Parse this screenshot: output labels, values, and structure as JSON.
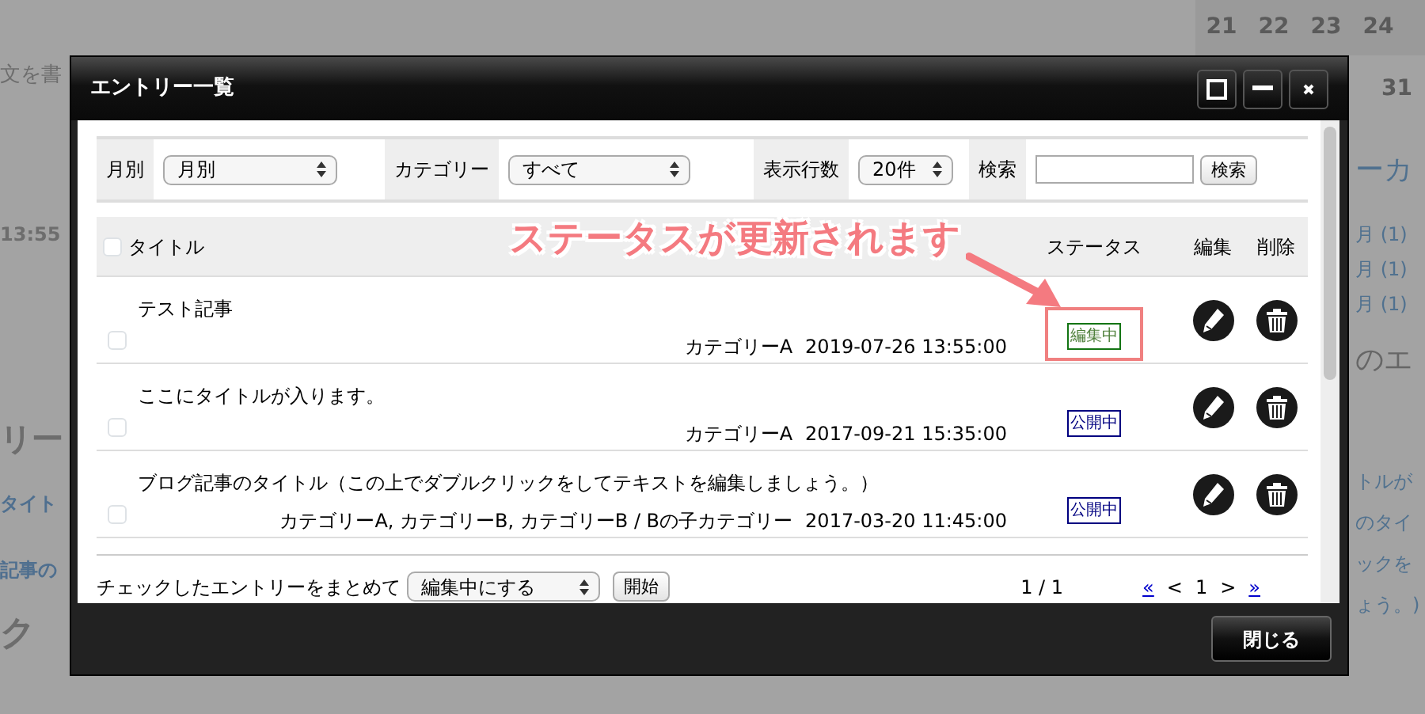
{
  "background": {
    "calendar": [
      "21",
      "22",
      "23",
      "24"
    ],
    "calendar_row_2": [
      "31"
    ],
    "left_texts": [
      "文を書",
      "13:55",
      "リー",
      "タイト",
      "記事の",
      "ク"
    ],
    "right_texts": [
      "ーカ",
      "月 (1)",
      "月 (1)",
      "月 (1)",
      "のエ",
      "トルが",
      "のタイ",
      "ックを",
      "ょう。)"
    ]
  },
  "window": {
    "title": "エントリー一覧"
  },
  "filters": [
    {
      "label": "月別",
      "value": "月別"
    },
    {
      "label": "カテゴリー",
      "value": "すべて"
    },
    {
      "label": "表示行数",
      "value": "20件"
    }
  ],
  "search": {
    "label": "検索",
    "button": "検索"
  },
  "table": {
    "select_all_checked": false,
    "columns": [
      "タイトル",
      "ステータス",
      "編集",
      "削除"
    ],
    "rows": [
      {
        "checked": false,
        "title": "テスト記事",
        "category": "カテゴリーA",
        "date": "2019-07-26 13:55:00",
        "status": "編集中",
        "kind": "draft",
        "highlighted": true
      },
      {
        "checked": false,
        "title": "ここにタイトルが入ります。",
        "category": "カテゴリーA",
        "date": "2017-09-21 15:35:00",
        "status": "公開中",
        "kind": "published",
        "highlighted": false
      },
      {
        "checked": false,
        "title": "ブログ記事のタイトル（この上でダブルクリックをしてテキストを編集しましょう。）",
        "category": "カテゴリーA, カテゴリーB, カテゴリーB / Bの子カテゴリー",
        "date": "2017-03-20 11:45:00",
        "status": "公開中",
        "kind": "published",
        "highlighted": false
      }
    ]
  },
  "annotation": {
    "text": "ステータスが更新されます"
  },
  "bulk": {
    "label": "チェックしたエントリーをまとめて",
    "value": "編集中にする",
    "button": "開始"
  },
  "pagination": {
    "count": "1 / 1",
    "items": [
      {
        "text": "«",
        "kind": "link"
      },
      {
        "text": "<",
        "kind": "text"
      },
      {
        "text": "1",
        "kind": "text"
      },
      {
        "text": ">",
        "kind": "text"
      },
      {
        "text": "»",
        "kind": "link"
      }
    ]
  },
  "footer": {
    "button": "閉じる"
  }
}
